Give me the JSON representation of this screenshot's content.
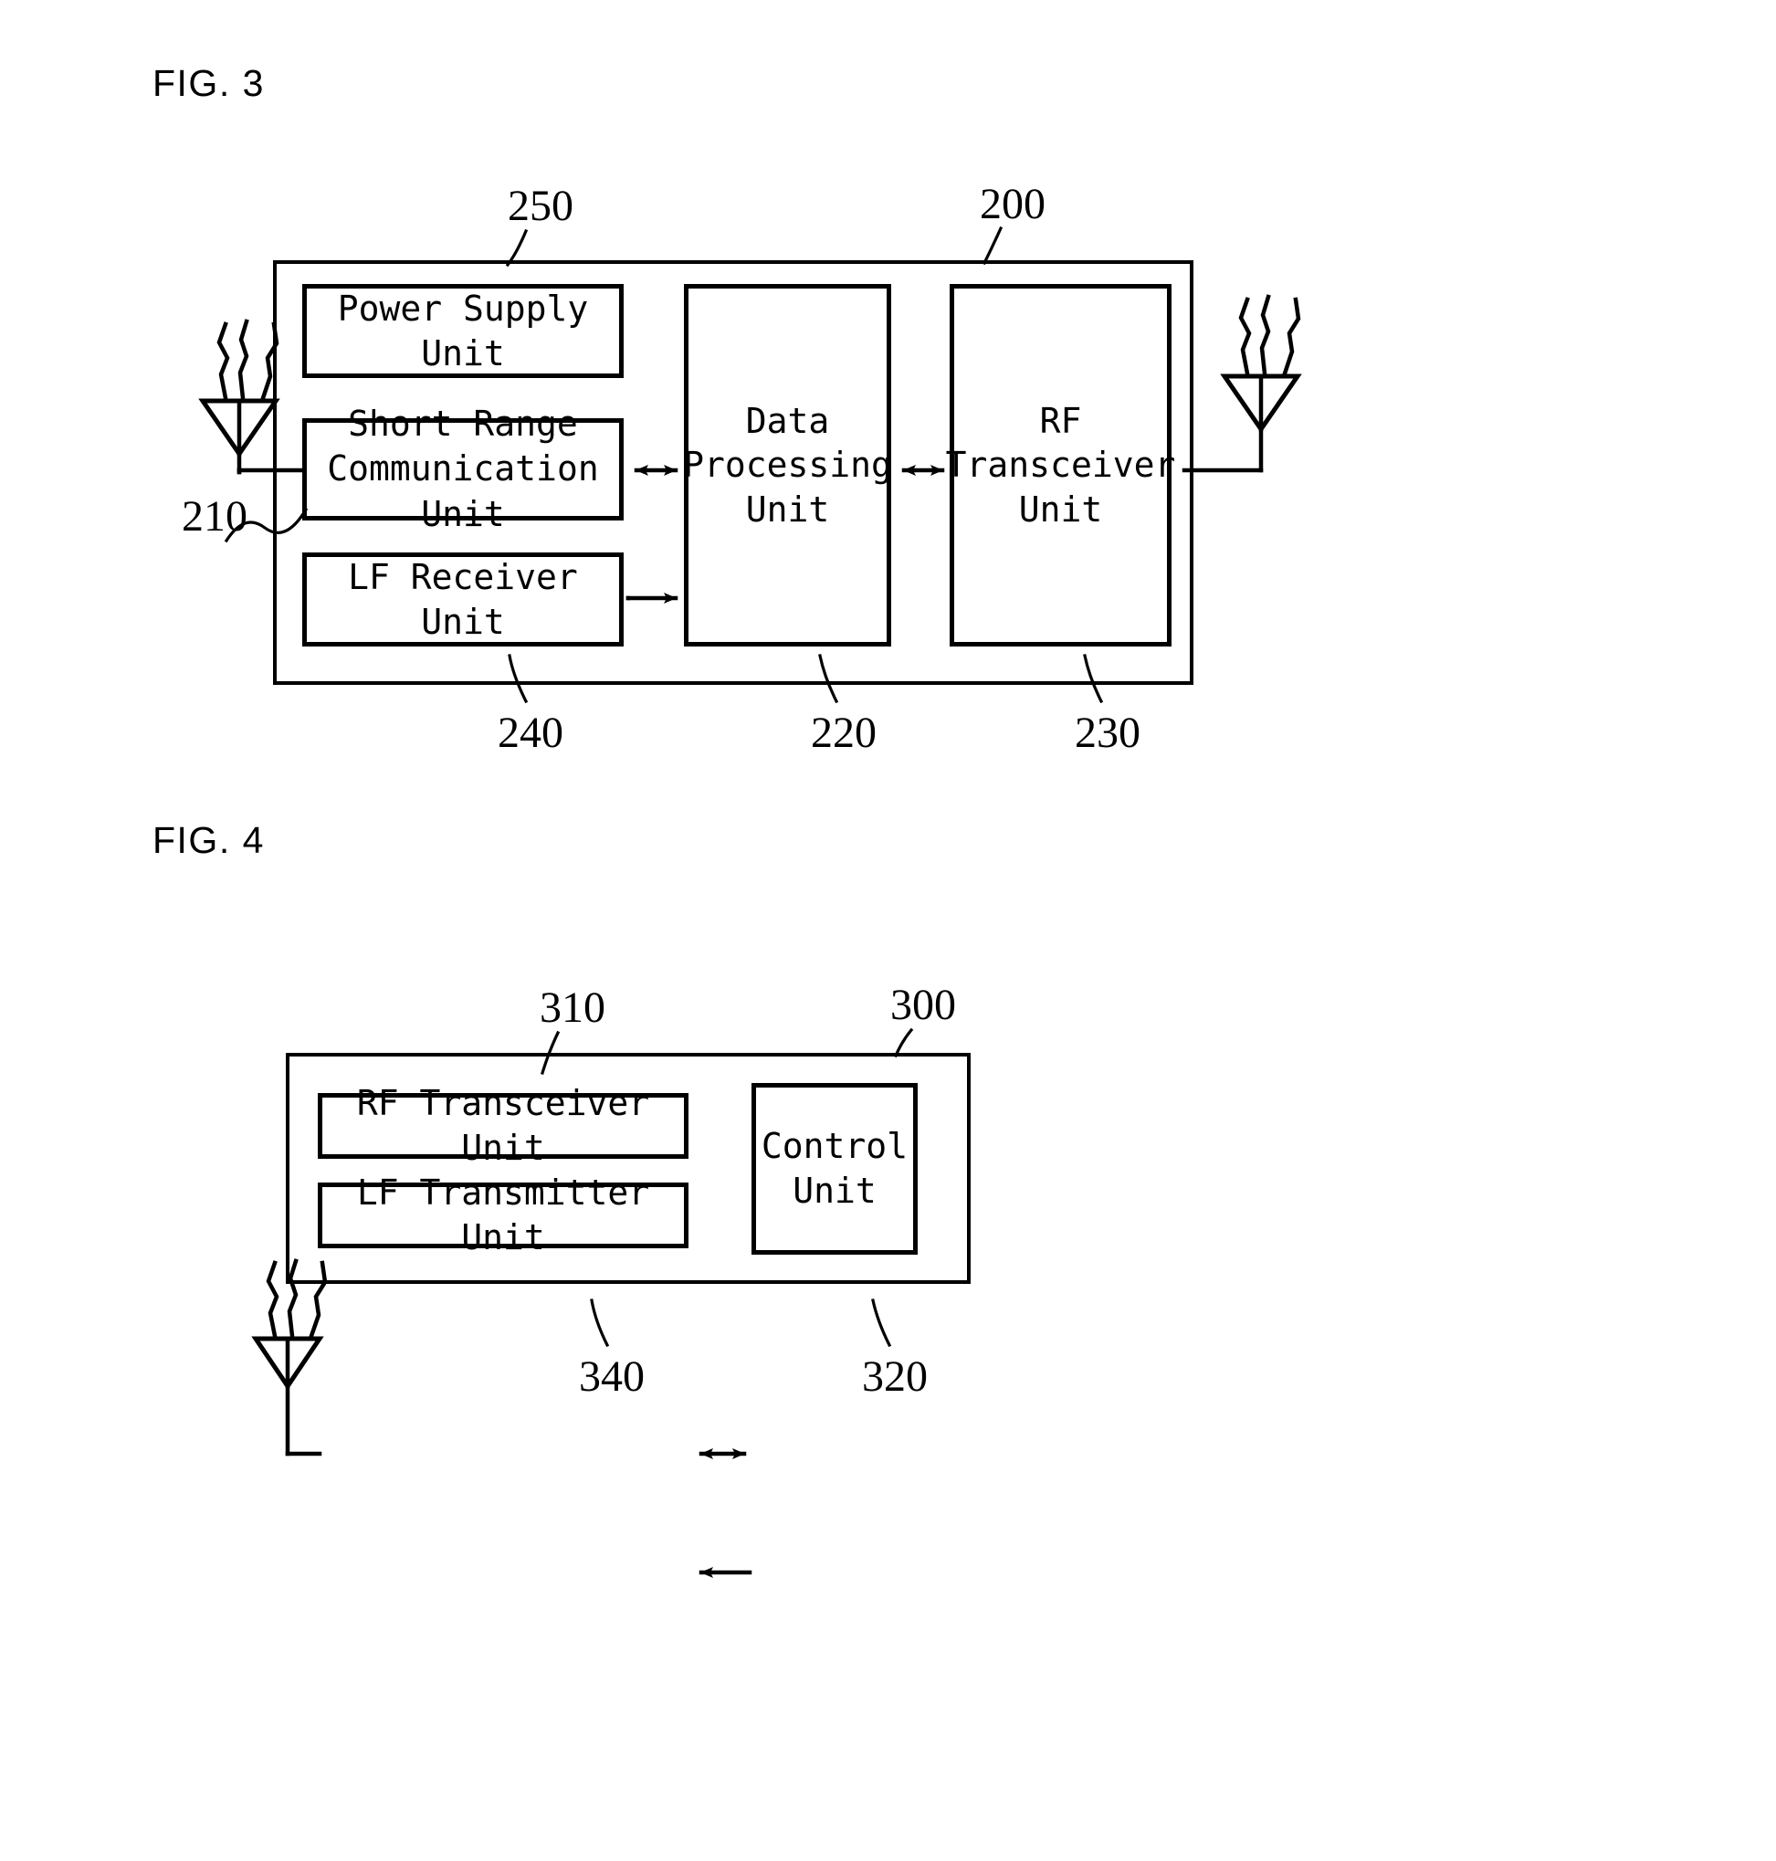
{
  "document": {
    "type": "patent-figure-sheet",
    "figures": [
      {
        "caption": "FIG. 3",
        "outer_ref": "200",
        "blocks": [
          {
            "ref": "250",
            "label": "Power Supply Unit"
          },
          {
            "ref": "210",
            "label": "Short Range\nCommunication Unit"
          },
          {
            "ref": "240",
            "label": "LF Receiver Unit"
          },
          {
            "ref": "220",
            "label": "Data\nProcessing\nUnit"
          },
          {
            "ref": "230",
            "label": "RF\nTransceiver\nUnit"
          }
        ],
        "antennas": [
          "left-antenna",
          "right-antenna"
        ],
        "connections": [
          {
            "from": "Short Range Communication Unit",
            "to": "Data Processing Unit",
            "arrow": "double"
          },
          {
            "from": "LF Receiver Unit",
            "to": "Data Processing Unit",
            "arrow": "single"
          },
          {
            "from": "Data Processing Unit",
            "to": "RF Transceiver Unit",
            "arrow": "double"
          }
        ]
      },
      {
        "caption": "FIG. 4",
        "outer_ref": "300",
        "blocks": [
          {
            "ref": "310",
            "label": "RF Transceiver Unit"
          },
          {
            "ref": "340",
            "label": "LF Transmitter Unit"
          },
          {
            "ref": "320",
            "label": "Control\nUnit"
          }
        ],
        "antennas": [
          "left-antenna"
        ],
        "connections": [
          {
            "from": "RF Transceiver Unit",
            "to": "Control Unit",
            "arrow": "double"
          },
          {
            "from": "Control Unit",
            "to": "LF Transmitter Unit",
            "arrow": "single"
          }
        ]
      }
    ]
  },
  "fig3": {
    "caption": "FIG. 3",
    "ref_200": "200",
    "ref_250": "250",
    "ref_210": "210",
    "ref_240": "240",
    "ref_220": "220",
    "ref_230": "230",
    "power_supply_unit": "Power Supply Unit",
    "short_range_unit": "Short Range\nCommunication Unit",
    "lf_receiver_unit": "LF Receiver Unit",
    "data_processing_unit": "Data\nProcessing\nUnit",
    "rf_transceiver_unit": "RF\nTransceiver\nUnit"
  },
  "fig4": {
    "caption": "FIG. 4",
    "ref_300": "300",
    "ref_310": "310",
    "ref_340": "340",
    "ref_320": "320",
    "rf_transceiver_unit": "RF Transceiver Unit",
    "lf_transmitter_unit": "LF Transmitter Unit",
    "control_unit": "Control\nUnit"
  },
  "colors": {
    "ink": "#000000",
    "paper": "#ffffff"
  }
}
